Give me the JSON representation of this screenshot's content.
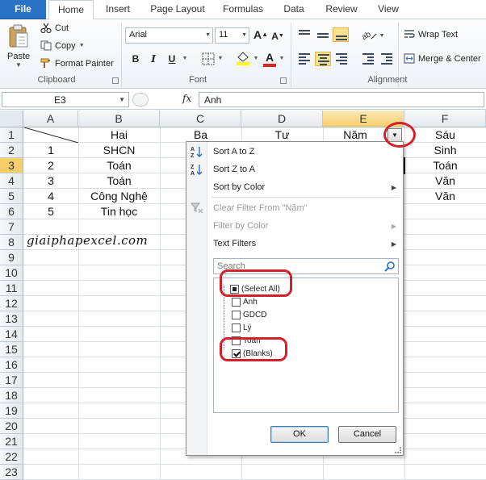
{
  "ribbon_tabs": [
    {
      "label": "File",
      "active": false
    },
    {
      "label": "Home",
      "active": true
    },
    {
      "label": "Insert",
      "active": false
    },
    {
      "label": "Page Layout",
      "active": false
    },
    {
      "label": "Formulas",
      "active": false
    },
    {
      "label": "Data",
      "active": false
    },
    {
      "label": "Review",
      "active": false
    },
    {
      "label": "View",
      "active": false
    }
  ],
  "clipboard": {
    "paste_label": "Paste",
    "cut_label": "Cut",
    "copy_label": "Copy",
    "format_painter_label": "Format Painter",
    "group_label": "Clipboard"
  },
  "font": {
    "font_name": "Arial",
    "font_size": "11",
    "bold": "B",
    "italic": "I",
    "underline": "U",
    "group_label": "Font",
    "fill_color": "#ffff00",
    "font_color": "#e02020"
  },
  "alignment": {
    "wrap_text_label": "Wrap Text",
    "merge_label": "Merge & Center",
    "group_label": "Alignment"
  },
  "formula_bar": {
    "name_box": "E3",
    "fx": "fx",
    "content": "Anh"
  },
  "columns": [
    "A",
    "B",
    "C",
    "D",
    "E",
    "F"
  ],
  "selected_column": "E",
  "rows": [
    "1",
    "2",
    "3",
    "4",
    "5",
    "6",
    "7",
    "8",
    "9",
    "10",
    "11",
    "12",
    "13",
    "14",
    "15",
    "16",
    "17",
    "18",
    "19",
    "20",
    "21",
    "22",
    "23"
  ],
  "selected_row": "3",
  "cells": {
    "B1": "Hai",
    "C1": "Ba",
    "D1": "Tư",
    "E1": "Năm",
    "F1": "Sáu",
    "A2": "1",
    "B2": "SHCN",
    "F2": "Sinh",
    "A3": "2",
    "B3": "Toán",
    "F3": "Toán",
    "A4": "3",
    "B4": "Toán",
    "F4": "Văn",
    "A5": "4",
    "B5": "Công Nghệ",
    "F5": "Văn",
    "A6": "5",
    "B6": "Tin học"
  },
  "watermark": "giaiphapexcel.com",
  "filter_menu": {
    "sort_az": "Sort A to Z",
    "sort_za": "Sort Z to A",
    "sort_by_color": "Sort by Color",
    "clear_filter": "Clear Filter From \"Năm\"",
    "filter_by_color": "Filter by Color",
    "text_filters": "Text Filters",
    "search_placeholder": "Search",
    "items": [
      {
        "label": "(Select All)",
        "state": "partial"
      },
      {
        "label": "Anh",
        "state": "unchecked"
      },
      {
        "label": "GDCD",
        "state": "unchecked"
      },
      {
        "label": "Lý",
        "state": "unchecked"
      },
      {
        "label": "Toán",
        "state": "unchecked"
      },
      {
        "label": "(Blanks)",
        "state": "checked"
      }
    ],
    "ok_label": "OK",
    "cancel_label": "Cancel"
  },
  "annotation_color": "#d4202b"
}
